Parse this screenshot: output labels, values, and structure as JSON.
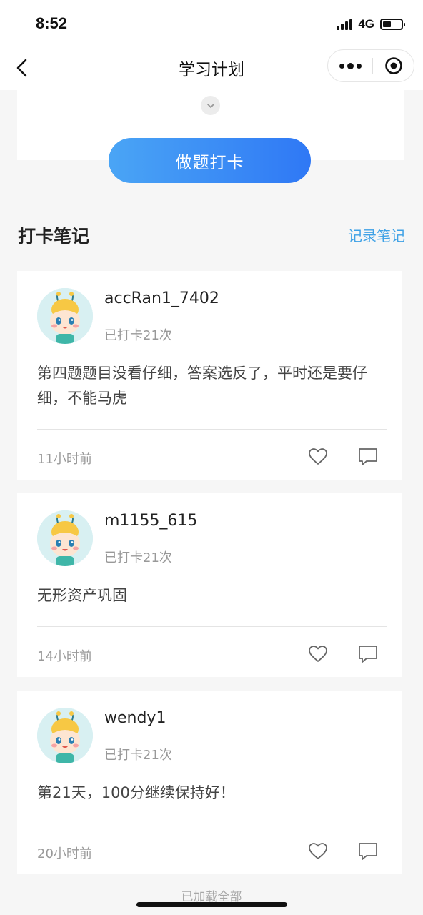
{
  "status": {
    "time": "8:52",
    "network": "4G"
  },
  "nav": {
    "title": "学习计划"
  },
  "plan": {
    "checkin_button": "做题打卡"
  },
  "section": {
    "title": "打卡笔记",
    "record_link": "记录笔记"
  },
  "notes": [
    {
      "username": "accRan1_7402",
      "count": "已打卡21次",
      "content": "第四题题目没看仔细，答案选反了，平时还是要仔细，不能马虎",
      "time": "11小时前"
    },
    {
      "username": "m1155_615",
      "count": "已打卡21次",
      "content": "无形资产巩固",
      "time": "14小时前"
    },
    {
      "username": "wendy1",
      "count": "已打卡21次",
      "content": "第21天，100分继续保持好！",
      "time": "20小时前"
    }
  ],
  "footer": {
    "loaded_text": "已加载全部"
  },
  "icons": {
    "back": "chevron-left-icon",
    "more": "more-dots-icon",
    "close": "target-close-icon",
    "expand": "chevron-down-icon",
    "like": "heart-outline-icon",
    "comment": "comment-icon"
  },
  "colors": {
    "accent": "#3ea1e6",
    "button_start": "#4aa5f5",
    "button_end": "#2f78f5"
  }
}
